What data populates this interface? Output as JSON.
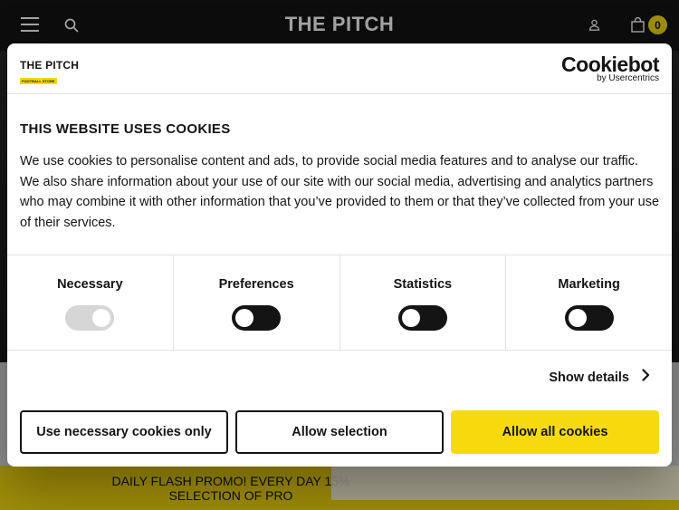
{
  "colors": {
    "accent_yellow": "#f6da0e",
    "dark": "#141414",
    "header_bg": "#141414"
  },
  "site_header": {
    "logo_text": "THE PITCH",
    "bag_count": "0",
    "icons": [
      "menu-icon",
      "search-icon",
      "account-icon",
      "bag-icon"
    ]
  },
  "promo": {
    "line1": "DAILY FLASH PROMO! EVERY DAY 15%",
    "line2": "SELECTION OF PRO"
  },
  "cookie_dialog": {
    "brand_logo": {
      "line1": "THE PITCH",
      "line2": "FOOTBALL STORE"
    },
    "cookiebot_logo": {
      "name": "Cookiebot",
      "byline": "by Usercentrics"
    },
    "title": "THIS WEBSITE USES COOKIES",
    "text": "We use cookies to personalise content and ads, to provide social media features and to analyse our traffic. We also share information about your use of our site with our social media, advertising and analytics partners who may combine it with other information that you’ve provided to them or that they’ve collected from your use of their services.",
    "categories": [
      {
        "label": "Necessary",
        "enabled": true,
        "locked": true
      },
      {
        "label": "Preferences",
        "enabled": false,
        "locked": false
      },
      {
        "label": "Statistics",
        "enabled": false,
        "locked": false
      },
      {
        "label": "Marketing",
        "enabled": false,
        "locked": false
      }
    ],
    "show_details_label": "Show details",
    "buttons": {
      "necessary_only": "Use necessary cookies only",
      "allow_selection": "Allow selection",
      "allow_all": "Allow all cookies"
    }
  }
}
